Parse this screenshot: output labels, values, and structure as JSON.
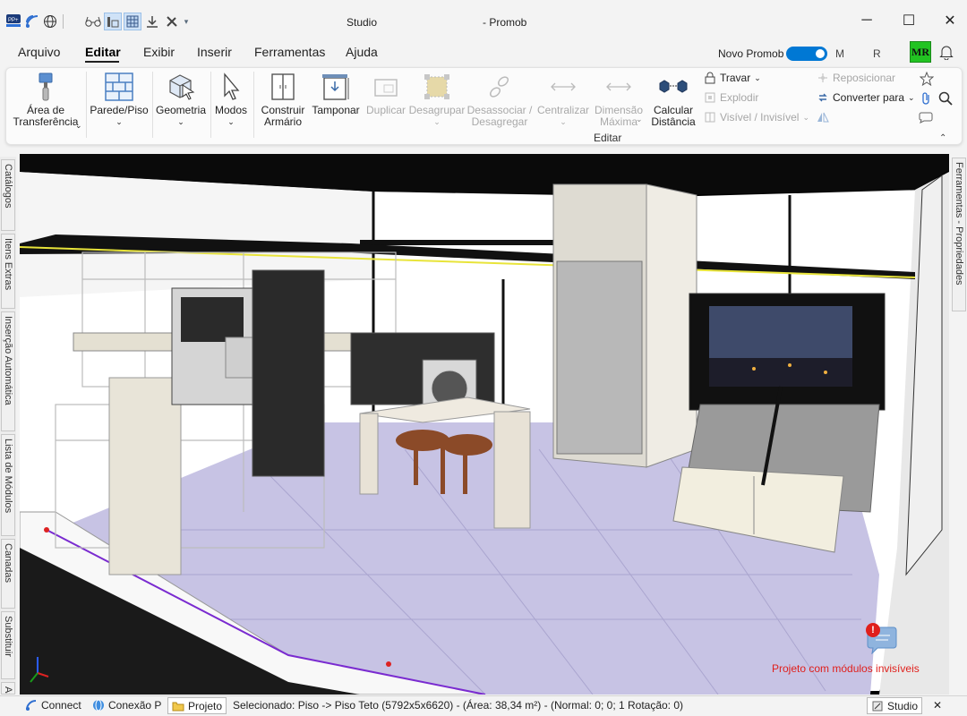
{
  "window": {
    "title": "Studio",
    "app_title": "- Promob",
    "min": "─",
    "max": "☐",
    "close": "✕"
  },
  "menu": {
    "items": [
      "Arquivo",
      "Editar",
      "Exibir",
      "Inserir",
      "Ferramentas",
      "Ajuda"
    ]
  },
  "account": {
    "toggle_label": "Novo Promob",
    "m": "M",
    "r": "R",
    "avatar": "MR"
  },
  "ribbon": {
    "transfer_area": "Área de Transferência",
    "wall_floor": "Parede/Piso",
    "geometry": "Geometria",
    "modes": "Modos",
    "build_cabinet": "Construir Armário",
    "cap": "Tamponar",
    "duplicate": "Duplicar",
    "ungroup": "Desagrupar",
    "dissociate": "Desassociar / Desagregar",
    "center": "Centralizar",
    "max_dimension": "Dimensão Máxima",
    "calc_distance": "Calcular Distância",
    "lock": "Travar",
    "explode": "Explodir",
    "visible_invisible": "Visível / Invisível",
    "reposition": "Reposicionar",
    "convert_to": "Converter para",
    "group_label": "Editar"
  },
  "side_tabs": {
    "left": [
      "Catálogos",
      "Itens Extras",
      "Inserção Automática",
      "Lista de Módulos",
      "Canadas",
      "Substituir",
      "As"
    ],
    "right": "Ferramentas - Propriedades"
  },
  "viewport": {
    "warning": "Projeto com módulos invisíveis",
    "alert_badge": "!"
  },
  "status": {
    "connect": "Connect",
    "conexao": "Conexão P",
    "projeto": "Projeto",
    "selection": "Selecionado: Piso -> Piso Teto (5792x5x6620) - (Área: 38,34 m²) - (Normal: 0; 0; 1 Rotação: 0)",
    "studio": "Studio",
    "close": "✕"
  },
  "colors": {
    "accent": "#0078d4",
    "avatar_bg": "#22c322",
    "warning": "#e0201c",
    "floor": "#c7c3e4"
  }
}
